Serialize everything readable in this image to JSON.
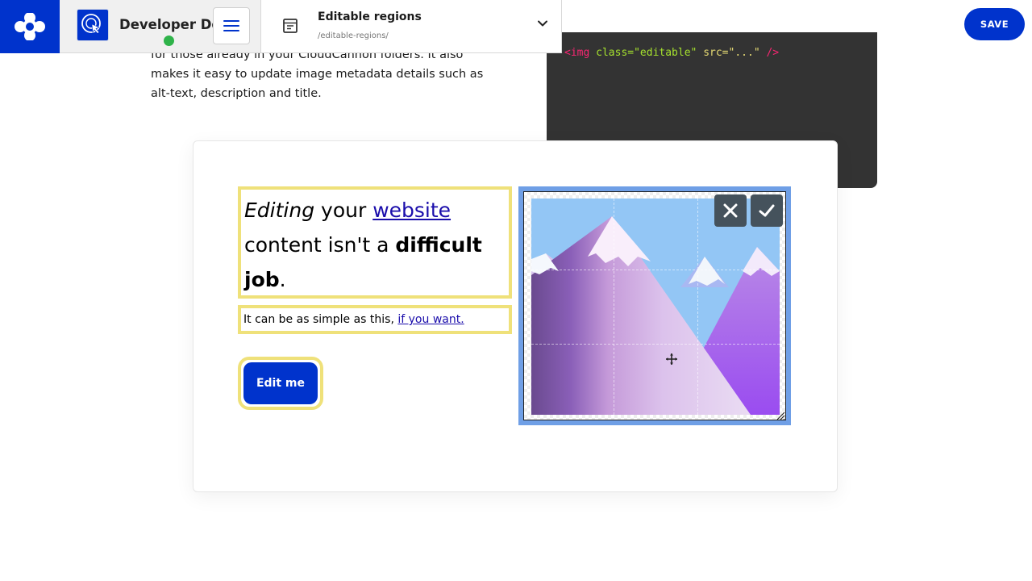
{
  "toolbar": {
    "site_name": "Developer Demo",
    "file_title": "Editable regions",
    "file_path": "/editable-regions/",
    "save_label": "SAVE"
  },
  "page": {
    "intro_line1": "for those already in your CloudCannon folders. It also",
    "intro_line2": "makes it easy to update image metadata details such as",
    "intro_line3": "alt-text, description and title.",
    "code_tag": "<img",
    "code_attr": "class=\"editable\"",
    "code_src": "src=\"...\"",
    "code_end": "/>"
  },
  "demo": {
    "heading_em": "Editing",
    "heading_t1": " your ",
    "heading_link": "website",
    "heading_t2": " content isn't a ",
    "heading_strong1": "difficult",
    "heading_t3": " ",
    "heading_strong2": "job",
    "heading_t4": ".",
    "para_text": "It can be as simple as this, ",
    "para_link": "if you want.",
    "button_label": "Edit me"
  },
  "colors": {
    "brand_blue": "#0033cc",
    "region_outline": "#efe17a",
    "selected_outline": "#6f9fe6",
    "status_green": "#2fb34a"
  },
  "icons": [
    "cloudcannon-logo-icon",
    "site-cursor-icon",
    "hamburger-menu-icon",
    "file-layout-icon",
    "chevron-down-icon",
    "close-icon",
    "check-icon",
    "move-icon",
    "resize-handle-icon"
  ]
}
